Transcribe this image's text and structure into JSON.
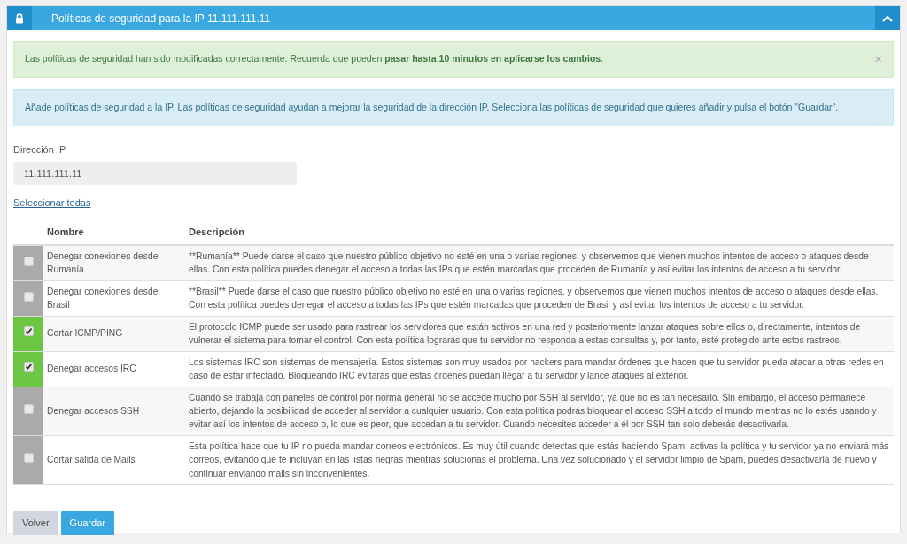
{
  "panel": {
    "title": "Políticas de seguridad para la IP 11.111.111.11",
    "expanded": true
  },
  "success_alert": {
    "text": "Las políticas de seguridad han sido modificadas correctamente. Recuerda que pueden **pasar hasta 10 minutos en aplicarse los cambios**.",
    "close": "×"
  },
  "info_alert": {
    "text": "Añade políticas de seguridad a la IP. Las políticas de seguridad ayudan a mejorar la seguridad de la dirección IP. Selecciona las políticas de seguridad que quieres añadir y pulsa el botón \"Guardar\"."
  },
  "ip_field": {
    "label": "Dirección IP",
    "value": "11.111.111.11"
  },
  "select_all": "Seleccionar todas",
  "table": {
    "columns": [
      "Nombre",
      "Descripción"
    ],
    "rows": [
      {
        "name": "Denegar conexiones desde Rumanía",
        "description": "**Rumanía** Puede darse el caso que nuestro público objetivo no esté en una o varias regiones, y observemos que vienen muchos intentos de acceso o ataques desde ellas. Con esta política puedes denegar el acceso a todas las IPs que estén marcadas que proceden de Rumanía y así evitar los intentos de acceso a tu servidor.",
        "checked": false
      },
      {
        "name": "Denegar conexiones desde Brasil",
        "description": "**Brasil** Puede darse el caso que nuestro público objetivo no esté en una o varias regiones, y observemos que vienen muchos intentos de acceso o ataques desde ellas. Con esta política puedes denegar el acceso a todas las IPs que estén marcadas que proceden de Brasil y así evitar los intentos de acceso a tu servidor.",
        "checked": false
      },
      {
        "name": "Cortar ICMP/PING",
        "description": "El protocolo ICMP puede ser usado para rastrear los servidores que están activos en una red y posteriormente lanzar ataques sobre ellos o, directamente, intentos de vulnerar el sistema para tomar el control. Con esta política lograrás que tu servidor no responda a estas consultas y, por tanto, esté protegido ante estos rastreos.",
        "checked": true
      },
      {
        "name": "Denegar accesos IRC",
        "description": "Los sistemas IRC son sistemas de mensajería. Estos sistemas son muy usados por hackers para mandar órdenes que hacen que tu servidor pueda atacar a otras redes en caso de estar infectado. Bloqueando IRC evitarás que estas órdenes puedan llegar a tu servidor y lance ataques al exterior.",
        "checked": true
      },
      {
        "name": "Denegar accesos SSH",
        "description": "Cuando se trabaja con paneles de control por norma general no se accede mucho por SSH al servidor, ya que no es tan necesario. Sin embargo, el acceso permanece abierto, dejando la posibilidad de acceder al servidor a cualquier usuario. Con esta política podrás bloquear el acceso SSH a todo el mundo mientras no lo estés usando y evitar así los intentos de acceso o, lo que es peor, que accedan a tu servidor. Cuando necesites acceder a él por SSH tan solo deberás desactivarla.",
        "checked": false
      },
      {
        "name": "Cortar salida de Mails",
        "description": "Esta política hace que tu IP no pueda mandar correos electrónicos. Es muy útil cuando detectas que estás haciendo Spam: activas la política y tu servidor ya no enviará más correos, evitando que te incluyan en las listas negras mientras solucionas el problema. Una vez solucionado y el servidor limpio de Spam, puedes desactivarla de nuevo y continuar enviando mails sin inconvenientes.",
        "checked": false
      }
    ]
  },
  "buttons": [
    {
      "label": "Volver",
      "kind": "secondary"
    },
    {
      "label": "Guardar",
      "kind": "primary"
    }
  ]
}
